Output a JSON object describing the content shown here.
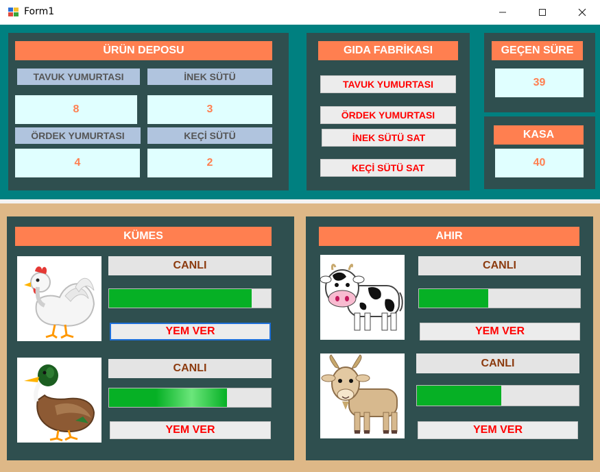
{
  "window": {
    "title": "Form1",
    "minimize": "—",
    "maximize": "☐",
    "close": "✕"
  },
  "urun_deposu": {
    "title": "ÜRÜN DEPOSU",
    "items": [
      {
        "label": "TAVUK YUMURTASI",
        "value": "8"
      },
      {
        "label": "İNEK SÜTÜ",
        "value": "3"
      },
      {
        "label": "ÖRDEK YUMURTASI",
        "value": "4"
      },
      {
        "label": "KEÇİ SÜTÜ",
        "value": "2"
      }
    ]
  },
  "gida_fabrikasi": {
    "title": "GIDA FABRİKASI",
    "buttons": [
      "TAVUK YUMURTASI",
      "ÖRDEK YUMURTASI",
      "İNEK SÜTÜ SAT",
      "KEÇİ SÜTÜ SAT"
    ]
  },
  "gecen_sure": {
    "title": "GEÇEN SÜRE",
    "value": "39"
  },
  "kasa": {
    "title": "KASA",
    "value": "40"
  },
  "kumes": {
    "title": "KÜMES",
    "animals": [
      {
        "icon": "chicken-icon",
        "status": "CANLI",
        "health": 0.88,
        "button": "YEM VER"
      },
      {
        "icon": "duck-icon",
        "status": "CANLI",
        "health": 0.73,
        "button": "YEM VER"
      }
    ]
  },
  "ahir": {
    "title": "AHIR",
    "animals": [
      {
        "icon": "cow-icon",
        "status": "CANLI",
        "health": 0.43,
        "button": "YEM VER"
      },
      {
        "icon": "goat-icon",
        "status": "CANLI",
        "health": 0.52,
        "button": "YEM VER"
      }
    ]
  },
  "colors": {
    "top_background": "#008080",
    "bottom_background": "#deb887",
    "panel": "#2f4f4f",
    "header": "#ff7f50",
    "label": "#b0c4de",
    "value_box": "#e0ffff",
    "button_text": "#ff0000",
    "progress": "#06b025"
  }
}
